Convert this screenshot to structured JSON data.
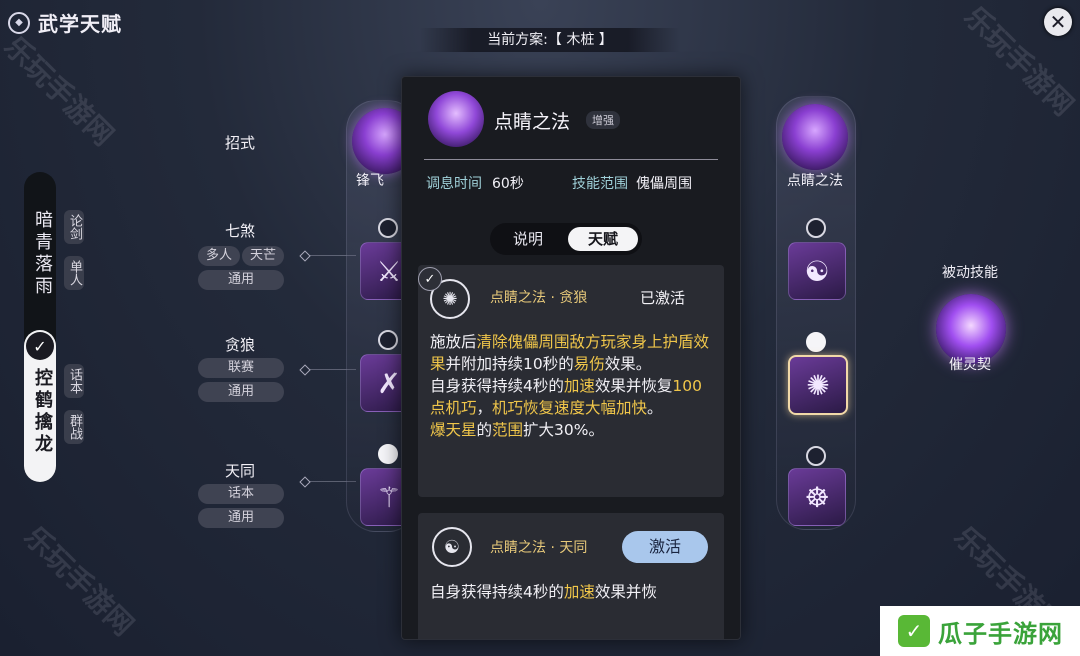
{
  "header": {
    "title": "武学天赋",
    "plan_label": "当前方案:【 木桩 】",
    "close_icon": "close-icon"
  },
  "watermark": "乐玩手游网",
  "sidebar": {
    "school_main": "暗青落雨",
    "school_active": "控鹤擒龙",
    "sub_tabs_top": [
      "论剑",
      "单人"
    ],
    "sub_tabs_bottom": [
      "话本",
      "群战"
    ]
  },
  "rows": {
    "header_label": "招式",
    "items": [
      {
        "label": "七煞",
        "tags": [
          "多人",
          "天芒"
        ],
        "tag2": "通用"
      },
      {
        "label": "贪狼",
        "tags": [
          "联赛"
        ],
        "tag2": "通用"
      },
      {
        "label": "天同",
        "tags": [
          "话本"
        ],
        "tag2": "通用"
      }
    ]
  },
  "columns": {
    "left_skill_name": "锋飞",
    "right_skill_name": "点睛之法"
  },
  "passive": {
    "title": "被动技能",
    "name": "催灵契"
  },
  "popup": {
    "skill_name": "点睛之法",
    "badge": "增强",
    "cooldown_label": "调息时间",
    "cooldown_value": "60秒",
    "range_label": "技能范围",
    "range_value": "傀儡周围",
    "tab_desc": "说明",
    "tab_talent": "天赋",
    "card1": {
      "title": "点睛之法 · 贪狼",
      "status": "已激活",
      "p1_a": "施放后",
      "p1_b": "清除傀儡周围敌方玩家身上护盾效果",
      "p1_c": "并附加持续10秒的",
      "p1_d": "易伤",
      "p1_e": "效果。",
      "p2_a": "自身获得持续4秒的",
      "p2_b": "加速",
      "p2_c": "效果并恢复",
      "p2_d": "100点机巧",
      "p2_e": "，",
      "p2_f": "机巧恢复速度大幅加快",
      "p2_g": "。",
      "p3_a": "爆天星",
      "p3_b": "的",
      "p3_c": "范围",
      "p3_d": "扩大30%。"
    },
    "card2": {
      "title": "点睛之法 · 天同",
      "button": "激活",
      "t_a": "自身获得持续4秒的",
      "t_b": "加速",
      "t_c": "效果并恢"
    }
  },
  "brand": {
    "text": "瓜子手游网",
    "color": "#59b836"
  }
}
